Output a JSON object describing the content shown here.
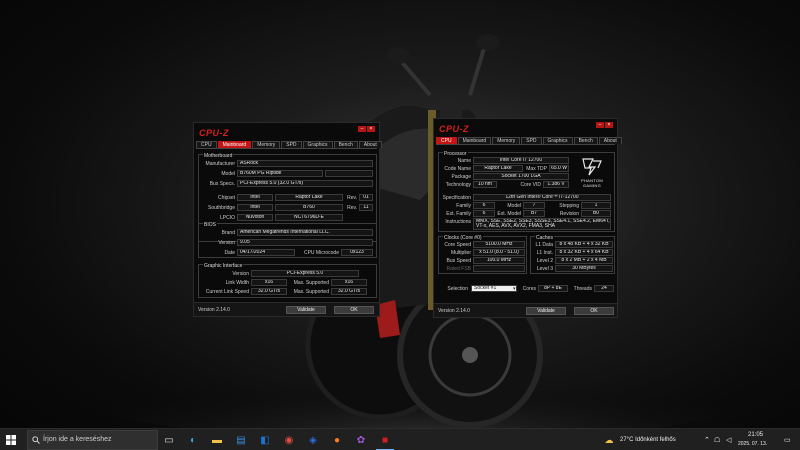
{
  "left_window": {
    "logo": "CPU-Z",
    "tabs": [
      "CPU",
      "Mainboard",
      "Memory",
      "SPD",
      "Graphics",
      "Bench",
      "About"
    ],
    "active_tab": "Mainboard",
    "motherboard": {
      "title": "Motherboard",
      "manufacturer_label": "Manufacturer",
      "manufacturer": "ASRock",
      "model_label": "Model",
      "model": "B760M PG Riptide",
      "bus_specs_label": "Bus Specs.",
      "bus_specs": "PCI-Express 5.0 (32.0 GT/s)",
      "chipset_label": "Chipset",
      "chipset_vendor": "Intel",
      "chipset_name": "Raptor Lake",
      "chipset_rev_label": "Rev.",
      "chipset_rev": "01",
      "southbridge_label": "Southbridge",
      "sb_vendor": "Intel",
      "sb_name": "B760",
      "sb_rev_label": "Rev.",
      "sb_rev": "11",
      "lpcio_label": "LPCIO",
      "lpcio_vendor": "Nuvoton",
      "lpcio_name": "NCT6796D-E"
    },
    "bios": {
      "title": "BIOS",
      "brand_label": "Brand",
      "brand": "American Megatrends International LLC.",
      "version_label": "Version",
      "version": "9.05",
      "date_label": "Date",
      "date": "04/17/2024",
      "microcode_label": "CPU Microcode",
      "microcode": "0x123"
    },
    "graphic_interface": {
      "title": "Graphic Interface",
      "version_label": "Version",
      "version": "PCI-Express 5.0",
      "link_width_label": "Link Width",
      "link_width": "x16",
      "max_supported_label": "Max. Supported",
      "max_width": "x16",
      "link_speed_label": "Current Link Speed",
      "link_speed": "32.0 GT/s",
      "max_speed_label": "Max. Supported",
      "max_speed": "32.0 GT/s"
    },
    "version": "Version 2.14.0",
    "validate": "Validate",
    "ok": "OK"
  },
  "right_window": {
    "logo": "CPU-Z",
    "tabs": [
      "CPU",
      "Mainboard",
      "Memory",
      "SPD",
      "Graphics",
      "Bench",
      "About"
    ],
    "active_tab": "CPU",
    "processor": {
      "title": "Processor",
      "name_label": "Name",
      "name": "Intel Core i7 12700",
      "code_name_label": "Code Name",
      "code_name": "Raptor Lake",
      "max_tdp_label": "Max TDP",
      "max_tdp": "65.0 W",
      "package_label": "Package",
      "package": "Socket 1700 LGA",
      "technology_label": "Technology",
      "technology": "10 nm",
      "core_vid_label": "Core VID",
      "core_vid": "1.386 V",
      "spec_label": "Specification",
      "spec": "12th Gen Intel® Core™ i7-12700",
      "family_label": "Family",
      "family": "6",
      "model_label": "Model",
      "model": "7",
      "stepping_label": "Stepping",
      "stepping": "1",
      "ext_family_label": "Ext. Family",
      "ext_family": "6",
      "ext_model_label": "Ext. Model",
      "ext_model": "B7",
      "revision_label": "Revision",
      "revision": "B0",
      "instructions_label": "Instructions",
      "instructions": "MMX, SSE, SSE2, SSE3, SSSE3, SSE4.1, SSE4.2, EM64T, VT-x, AES, AVX, AVX2, FMA3, SHA",
      "brand_logo_line1": "PHANTOM",
      "brand_logo_line2": "GAMING"
    },
    "clocks": {
      "title": "Clocks (Core #0)",
      "core_speed_label": "Core Speed",
      "core_speed": "5100.0 MHz",
      "multiplier_label": "Multiplier",
      "multiplier": "x 51.0 (8.0 - 51.0)",
      "bus_speed_label": "Bus Speed",
      "bus_speed": "100.0 MHz",
      "rated_fsb_label": "Rated FSB",
      "rated_fsb": ""
    },
    "caches": {
      "title": "Caches",
      "l1d_label": "L1 Data",
      "l1d": "8 x 48 KB + 4 x 32 KB",
      "l1i_label": "L1 Inst.",
      "l1i": "8 x 32 KB + 4 x 64 KB",
      "l2_label": "Level 2",
      "l2": "8 x 2 MB + 2 x 4 MB",
      "l3_label": "Level 3",
      "l3": "30 MBytes"
    },
    "selection_label": "Selection",
    "selection": "Socket #1",
    "cores_label": "Cores",
    "cores": "8P + 8E",
    "threads_label": "Threads",
    "threads": "24",
    "version": "Version 2.14.0",
    "validate": "Validate",
    "ok": "OK"
  },
  "taskbar": {
    "search_placeholder": "Írjon ide a kereséshez",
    "weather": "27°C  Időnként felhős",
    "time": "21:05",
    "date": "2025. 07. 13."
  }
}
